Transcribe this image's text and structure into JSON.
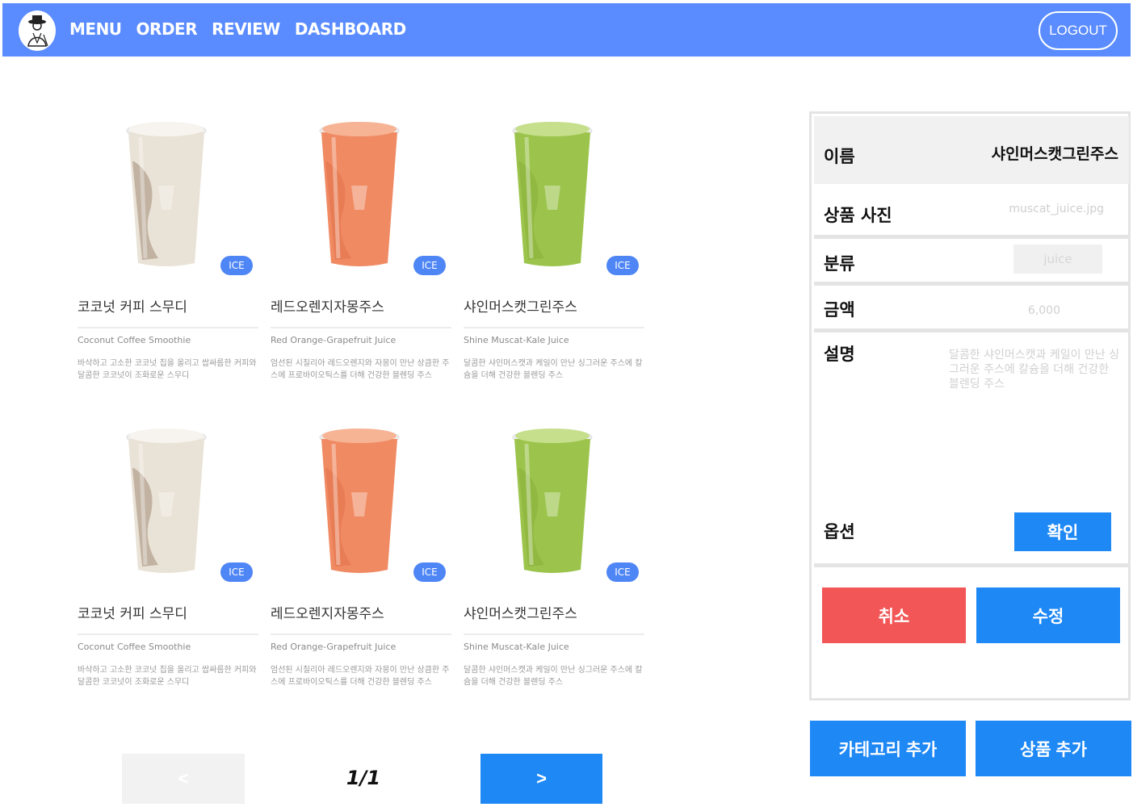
{
  "nav": {
    "logo_icon": "person-in-hat-logo-icon",
    "links": [
      "MENU",
      "ORDER",
      "REVIEW",
      "DASHBOARD"
    ],
    "logout": "LOGOUT"
  },
  "products": [
    {
      "name": "코코넛 커피 스무디",
      "english": "Coconut Coffee Smoothie",
      "description": "바삭하고 고소한 코코넛 칩을 올리고 쌉싸름한 커피와 달콤한 코코넛이 조화로운 스무디",
      "badge": "ICE",
      "drink": "coconut-coffee-smoothie-cup-icon"
    },
    {
      "name": "레드오렌지자몽주스",
      "english": "Red Orange-Grapefruit Juice",
      "description": "엄선된 시칠리아 레드오렌지와 자몽이 만난 상큼한 주스에 프로바이오틱스를 더해 건강한 블렌딩 주스",
      "badge": "ICE",
      "drink": "red-orange-grapefruit-juice-cup-icon"
    },
    {
      "name": "샤인머스캣그린주스",
      "english": "Shine Muscat-Kale Juice",
      "description": "달콤한 샤인머스캣과 케일이 만난 싱그러운 주스에 칼슘을 더해 건강한 블렌딩 주스",
      "badge": "ICE",
      "drink": "shine-muscat-kale-juice-cup-icon"
    },
    {
      "name": "코코넛 커피 스무디",
      "english": "Coconut Coffee Smoothie",
      "description": "바삭하고 고소한 코코넛 칩을 올리고 쌉싸름한 커피와 달콤한 코코넛이 조화로운 스무디",
      "badge": "ICE",
      "drink": "coconut-coffee-smoothie-cup-icon"
    },
    {
      "name": "레드오렌지자몽주스",
      "english": "Red Orange-Grapefruit Juice",
      "description": "엄선된 시칠리아 레드오렌지와 자몽이 만난 상큼한 주스에 프로바이오틱스를 더해 건강한 블렌딩 주스",
      "badge": "ICE",
      "drink": "red-orange-grapefruit-juice-cup-icon"
    },
    {
      "name": "샤인머스캣그린주스",
      "english": "Shine Muscat-Kale Juice",
      "description": "달콤한 샤인머스캣과 케일이 만난 싱그러운 주스에 칼슘을 더해 건강한 블렌딩 주스",
      "badge": "ICE",
      "drink": "shine-muscat-kale-juice-cup-icon"
    }
  ],
  "pagination": {
    "prev": "<",
    "current": "1/1",
    "next": ">"
  },
  "detail": {
    "name_label": "이름",
    "name_value": "샤인머스캣그린주스",
    "photo_label": "상품 사진",
    "photo_value": "muscat_juice.jpg",
    "category_label": "분류",
    "category_value": "juice",
    "price_label": "금액",
    "price_value": "6,000",
    "desc_label": "설명",
    "desc_value": "달콤한 샤인머스캣과 케일이 만난 싱그러운 주스에 칼슘을 더해 건강한 블렌딩 주스",
    "option_label": "옵션",
    "confirm": "확인",
    "cancel": "취소",
    "edit": "수정"
  },
  "actions": {
    "add_category": "카테고리 추가",
    "add_product": "상품 추가"
  },
  "colors": {
    "nav_bg": "#5a8cff",
    "primary": "#1e88f5",
    "danger": "#f25656",
    "badge": "#4f86f5",
    "coconut": "#e9e2d6",
    "orange_juice": "#f08a63",
    "green_juice": "#9cc44c"
  }
}
